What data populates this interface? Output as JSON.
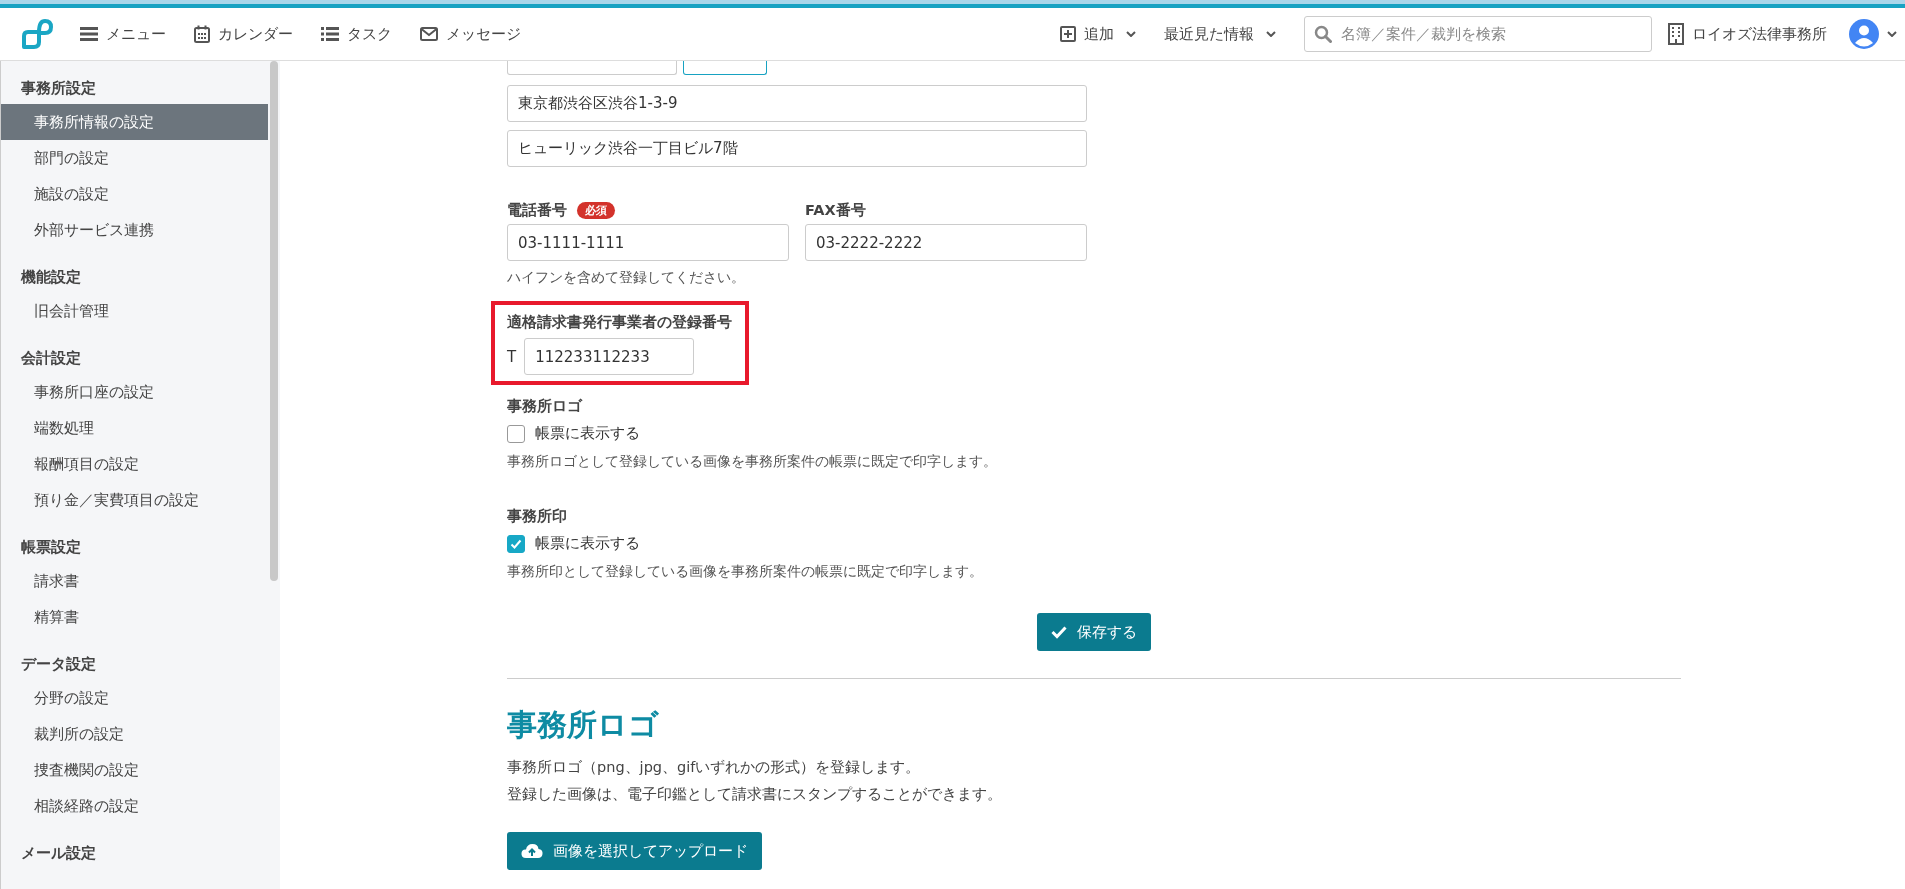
{
  "header": {
    "nav": [
      {
        "kind": "menu",
        "label": "メニュー"
      },
      {
        "kind": "calendar",
        "label": "カレンダー"
      },
      {
        "kind": "tasks",
        "label": "タスク"
      },
      {
        "kind": "mail",
        "label": "メッセージ"
      }
    ],
    "add": {
      "label": "追加"
    },
    "recent": {
      "label": "最近見た情報"
    },
    "search": {
      "placeholder": "名簿／案件／裁判を検索"
    },
    "office": {
      "label": "ロイオズ法律事務所"
    }
  },
  "sidebar": {
    "groups": [
      {
        "title": "事務所設定",
        "items": [
          {
            "label": "事務所情報の設定",
            "selected": true
          },
          {
            "label": "部門の設定",
            "selected": false
          },
          {
            "label": "施設の設定",
            "selected": false
          },
          {
            "label": "外部サービス連携",
            "selected": false
          }
        ]
      },
      {
        "title": "機能設定",
        "items": [
          {
            "label": "旧会計管理",
            "selected": false
          }
        ]
      },
      {
        "title": "会計設定",
        "items": [
          {
            "label": "事務所口座の設定",
            "selected": false
          },
          {
            "label": "端数処理",
            "selected": false
          },
          {
            "label": "報酬項目の設定",
            "selected": false
          },
          {
            "label": "預り金／実費項目の設定",
            "selected": false
          }
        ]
      },
      {
        "title": "帳票設定",
        "items": [
          {
            "label": "請求書",
            "selected": false
          },
          {
            "label": "精算書",
            "selected": false
          }
        ]
      },
      {
        "title": "データ設定",
        "items": [
          {
            "label": "分野の設定",
            "selected": false
          },
          {
            "label": "裁判所の設定",
            "selected": false
          },
          {
            "label": "捜査機関の設定",
            "selected": false
          },
          {
            "label": "相談経路の設定",
            "selected": false
          }
        ]
      },
      {
        "title": "メール設定"
      }
    ]
  },
  "form": {
    "address_lines": [
      "東京都渋谷区渋谷1-3-9",
      "ヒューリック渋谷一丁目ビル7階"
    ],
    "phone": {
      "label": "電話番号",
      "badge": "必須",
      "value": "03-1111-1111"
    },
    "fax": {
      "label": "FAX番号",
      "value": "03-2222-2222"
    },
    "phone_hint": "ハイフンを含めて登録してください。",
    "registration": {
      "label": "適格請求書発行事業者の登録番号",
      "prefix": "T",
      "value": "112233112233",
      "highlighted": true
    },
    "options": [
      {
        "title": "事務所ロゴ",
        "checkbox_label": "帳票に表示する",
        "checked": false,
        "description": "事務所ロゴとして登録している画像を事務所案件の帳票に既定で印字します。"
      },
      {
        "title": "事務所印",
        "checkbox_label": "帳票に表示する",
        "checked": true,
        "description": "事務所印として登録している画像を事務所案件の帳票に既定で印字します。"
      }
    ],
    "save_button": "保存する"
  },
  "logo_section": {
    "heading": "事務所ロゴ",
    "lines": [
      "事務所ロゴ（png、jpg、gifいずれかの形式）を登録します。",
      "登録した画像は、電子印鑑として請求書にスタンプすることができます。"
    ],
    "upload_button": "画像を選択してアップロード"
  }
}
